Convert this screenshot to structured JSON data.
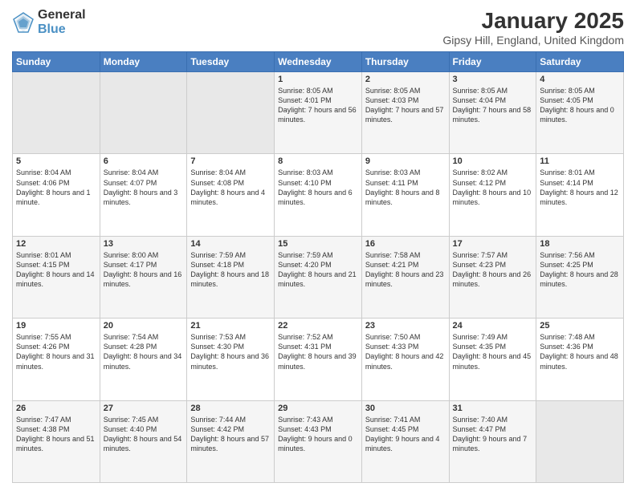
{
  "logo": {
    "line1": "General",
    "line2": "Blue"
  },
  "title": "January 2025",
  "subtitle": "Gipsy Hill, England, United Kingdom",
  "days_of_week": [
    "Sunday",
    "Monday",
    "Tuesday",
    "Wednesday",
    "Thursday",
    "Friday",
    "Saturday"
  ],
  "weeks": [
    [
      {
        "day": "",
        "info": ""
      },
      {
        "day": "",
        "info": ""
      },
      {
        "day": "",
        "info": ""
      },
      {
        "day": "1",
        "info": "Sunrise: 8:05 AM\nSunset: 4:01 PM\nDaylight: 7 hours and 56 minutes."
      },
      {
        "day": "2",
        "info": "Sunrise: 8:05 AM\nSunset: 4:03 PM\nDaylight: 7 hours and 57 minutes."
      },
      {
        "day": "3",
        "info": "Sunrise: 8:05 AM\nSunset: 4:04 PM\nDaylight: 7 hours and 58 minutes."
      },
      {
        "day": "4",
        "info": "Sunrise: 8:05 AM\nSunset: 4:05 PM\nDaylight: 8 hours and 0 minutes."
      }
    ],
    [
      {
        "day": "5",
        "info": "Sunrise: 8:04 AM\nSunset: 4:06 PM\nDaylight: 8 hours and 1 minute."
      },
      {
        "day": "6",
        "info": "Sunrise: 8:04 AM\nSunset: 4:07 PM\nDaylight: 8 hours and 3 minutes."
      },
      {
        "day": "7",
        "info": "Sunrise: 8:04 AM\nSunset: 4:08 PM\nDaylight: 8 hours and 4 minutes."
      },
      {
        "day": "8",
        "info": "Sunrise: 8:03 AM\nSunset: 4:10 PM\nDaylight: 8 hours and 6 minutes."
      },
      {
        "day": "9",
        "info": "Sunrise: 8:03 AM\nSunset: 4:11 PM\nDaylight: 8 hours and 8 minutes."
      },
      {
        "day": "10",
        "info": "Sunrise: 8:02 AM\nSunset: 4:12 PM\nDaylight: 8 hours and 10 minutes."
      },
      {
        "day": "11",
        "info": "Sunrise: 8:01 AM\nSunset: 4:14 PM\nDaylight: 8 hours and 12 minutes."
      }
    ],
    [
      {
        "day": "12",
        "info": "Sunrise: 8:01 AM\nSunset: 4:15 PM\nDaylight: 8 hours and 14 minutes."
      },
      {
        "day": "13",
        "info": "Sunrise: 8:00 AM\nSunset: 4:17 PM\nDaylight: 8 hours and 16 minutes."
      },
      {
        "day": "14",
        "info": "Sunrise: 7:59 AM\nSunset: 4:18 PM\nDaylight: 8 hours and 18 minutes."
      },
      {
        "day": "15",
        "info": "Sunrise: 7:59 AM\nSunset: 4:20 PM\nDaylight: 8 hours and 21 minutes."
      },
      {
        "day": "16",
        "info": "Sunrise: 7:58 AM\nSunset: 4:21 PM\nDaylight: 8 hours and 23 minutes."
      },
      {
        "day": "17",
        "info": "Sunrise: 7:57 AM\nSunset: 4:23 PM\nDaylight: 8 hours and 26 minutes."
      },
      {
        "day": "18",
        "info": "Sunrise: 7:56 AM\nSunset: 4:25 PM\nDaylight: 8 hours and 28 minutes."
      }
    ],
    [
      {
        "day": "19",
        "info": "Sunrise: 7:55 AM\nSunset: 4:26 PM\nDaylight: 8 hours and 31 minutes."
      },
      {
        "day": "20",
        "info": "Sunrise: 7:54 AM\nSunset: 4:28 PM\nDaylight: 8 hours and 34 minutes."
      },
      {
        "day": "21",
        "info": "Sunrise: 7:53 AM\nSunset: 4:30 PM\nDaylight: 8 hours and 36 minutes."
      },
      {
        "day": "22",
        "info": "Sunrise: 7:52 AM\nSunset: 4:31 PM\nDaylight: 8 hours and 39 minutes."
      },
      {
        "day": "23",
        "info": "Sunrise: 7:50 AM\nSunset: 4:33 PM\nDaylight: 8 hours and 42 minutes."
      },
      {
        "day": "24",
        "info": "Sunrise: 7:49 AM\nSunset: 4:35 PM\nDaylight: 8 hours and 45 minutes."
      },
      {
        "day": "25",
        "info": "Sunrise: 7:48 AM\nSunset: 4:36 PM\nDaylight: 8 hours and 48 minutes."
      }
    ],
    [
      {
        "day": "26",
        "info": "Sunrise: 7:47 AM\nSunset: 4:38 PM\nDaylight: 8 hours and 51 minutes."
      },
      {
        "day": "27",
        "info": "Sunrise: 7:45 AM\nSunset: 4:40 PM\nDaylight: 8 hours and 54 minutes."
      },
      {
        "day": "28",
        "info": "Sunrise: 7:44 AM\nSunset: 4:42 PM\nDaylight: 8 hours and 57 minutes."
      },
      {
        "day": "29",
        "info": "Sunrise: 7:43 AM\nSunset: 4:43 PM\nDaylight: 9 hours and 0 minutes."
      },
      {
        "day": "30",
        "info": "Sunrise: 7:41 AM\nSunset: 4:45 PM\nDaylight: 9 hours and 4 minutes."
      },
      {
        "day": "31",
        "info": "Sunrise: 7:40 AM\nSunset: 4:47 PM\nDaylight: 9 hours and 7 minutes."
      },
      {
        "day": "",
        "info": ""
      }
    ]
  ]
}
